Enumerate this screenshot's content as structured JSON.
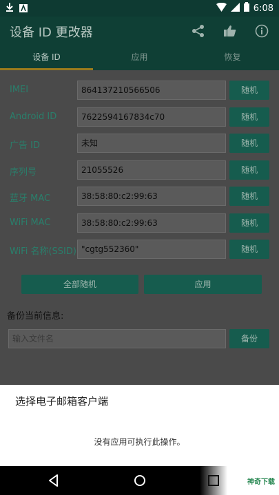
{
  "status_bar": {
    "time": "6:08"
  },
  "app_bar": {
    "title": "设备 ID 更改器"
  },
  "tabs": [
    {
      "label": "设备 ID"
    },
    {
      "label": "应用"
    },
    {
      "label": "恢复"
    }
  ],
  "rows": [
    {
      "label": "IMEI",
      "value": "864137210566506",
      "button": "随机"
    },
    {
      "label": "Android ID",
      "value": "7622594167834c70",
      "button": "随机"
    },
    {
      "label": "广告 ID",
      "value": "未知",
      "button": "随机"
    },
    {
      "label": "序列号",
      "value": "21055526",
      "button": "随机"
    },
    {
      "label": "蓝牙 MAC",
      "value": "38:58:80:c2:99:63",
      "button": "随机"
    },
    {
      "label": "WiFi MAC",
      "value": "38:58:80:c2:99:63",
      "button": "随机"
    },
    {
      "label": "WiFi 名称(SSID)",
      "value": "\"cgtg552360\"",
      "button": "随机"
    }
  ],
  "actions": {
    "randomize_all": "全部随机",
    "apply": "应用"
  },
  "backup": {
    "title": "备份当前信息:",
    "placeholder": "输入文件名",
    "button": "备份"
  },
  "sheet": {
    "title": "选择电子邮箱客户端",
    "message": "没有应用可执行此操作。"
  },
  "watermark": {
    "text": "神奇下载"
  }
}
